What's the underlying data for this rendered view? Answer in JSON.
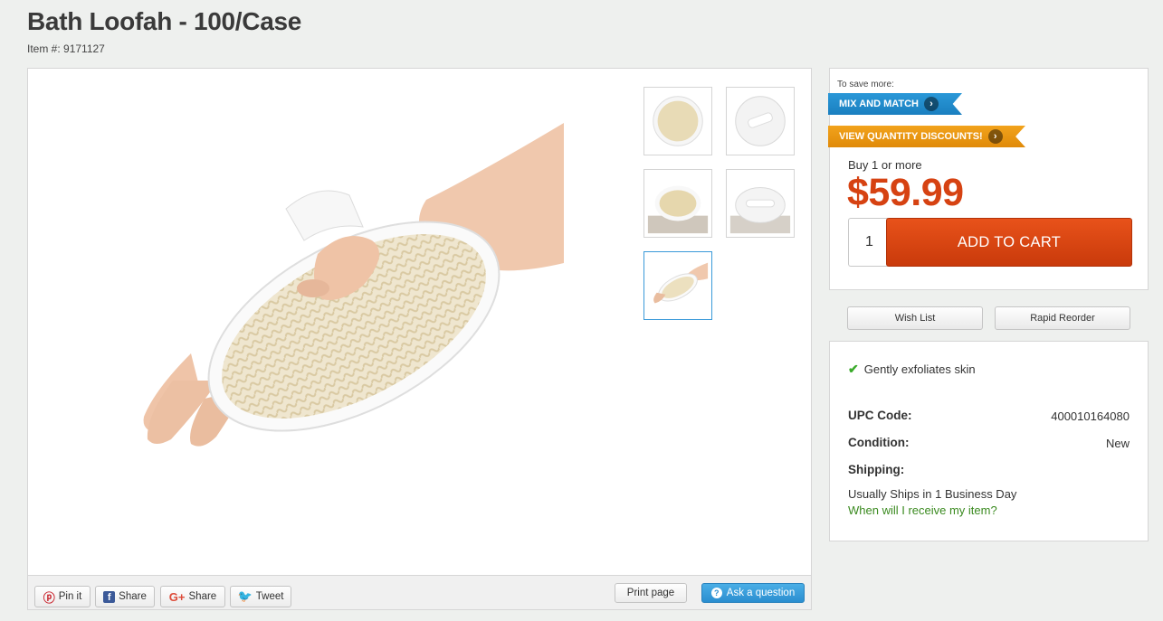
{
  "product": {
    "title": "Bath Loofah - 100/Case",
    "item_number": "Item #: 9171127"
  },
  "gallery": {
    "thumbnails": [
      "round-loofah-pad",
      "white-round-pad",
      "loofah-pad-on-surface",
      "white-pad-on-surface",
      "hand-with-loofah-mitt"
    ],
    "active_thumbnail": 4
  },
  "share": {
    "pinterest": "Pin it",
    "facebook": "Share",
    "google": "Share",
    "twitter": "Tweet",
    "print": "Print page",
    "ask": "Ask a question"
  },
  "buybox": {
    "save_more": "To save more:",
    "mix_and_match": "MIX AND MATCH",
    "quantity_discounts": "VIEW QUANTITY DISCOUNTS!",
    "buy_label": "Buy 1 or more",
    "price": "$59.99",
    "quantity": "1",
    "add_to_cart": "ADD TO CART"
  },
  "actions": {
    "wish_list": "Wish List",
    "rapid_reorder": "Rapid Reorder"
  },
  "details": {
    "feature": "Gently exfoliates skin",
    "upc_label": "UPC Code:",
    "upc_value": "400010164080",
    "condition_label": "Condition:",
    "condition_value": "New",
    "shipping_label": "Shipping:",
    "shipping_value": "Usually Ships in 1 Business Day",
    "receive_link": "When will I receive my item?"
  },
  "colors": {
    "price": "#d64212",
    "add_to_cart": "#d8470f",
    "mix_ribbon": "#1f8bcb",
    "discount_ribbon": "#eb9612",
    "link_green": "#3a8a1f",
    "thumb_active": "#3a9ad9"
  }
}
